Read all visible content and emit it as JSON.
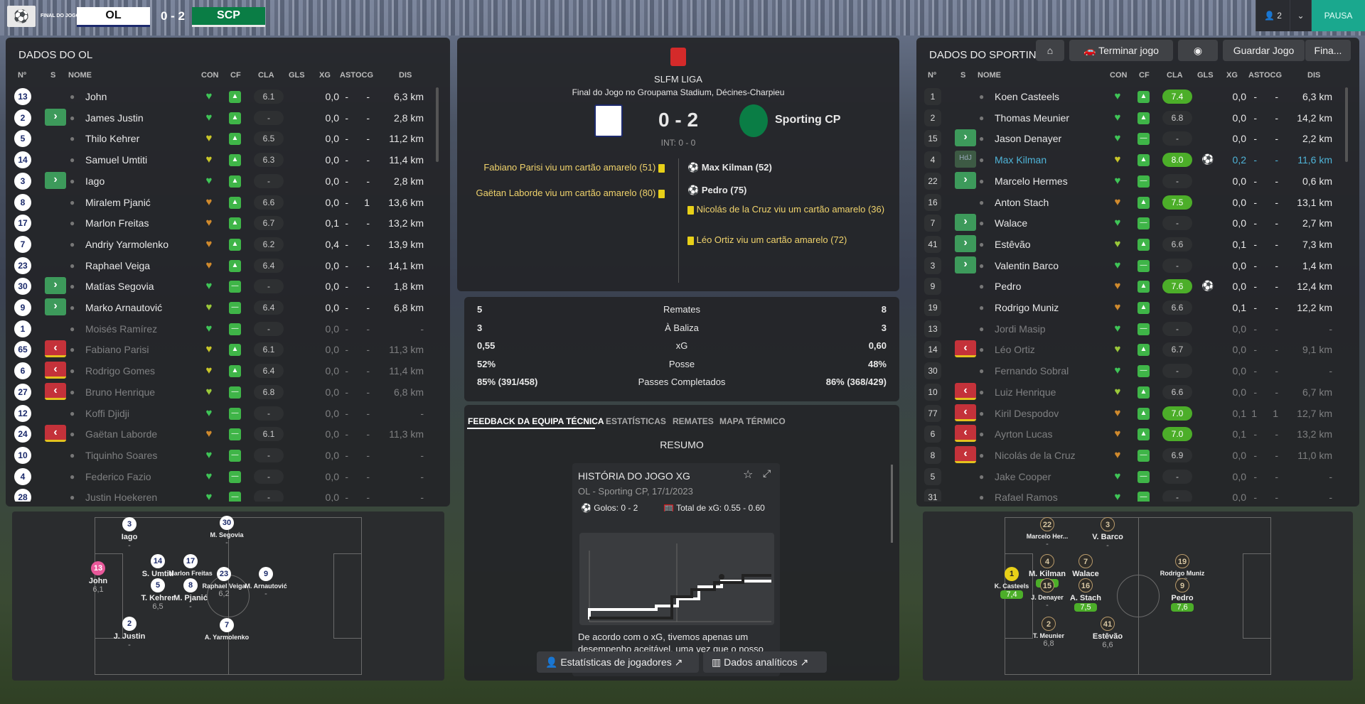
{
  "topbar": {
    "final_label": "FINAL DO JOGO",
    "home": "OL",
    "score": "0 - 2",
    "away": "SCP",
    "users": "2",
    "pause": "PAUSA"
  },
  "actions": {
    "terminate": "Terminar jogo",
    "save": "Guardar Jogo",
    "final": "Fina..."
  },
  "colors": {
    "accent": "#1aa88e",
    "good": "#4cae29",
    "yellow": "#e8d018",
    "red": "#c4323a",
    "sub_in": "#3d9a5b"
  },
  "headers": {
    "no": "Nº",
    "s": "S",
    "name": "NOME",
    "con": "CON",
    "cf": "CF",
    "cla": "CLA",
    "gls": "GLS",
    "xg": "XG",
    "ast": "AST",
    "ocg": "OCG",
    "dis": "DIS"
  },
  "left": {
    "title": "DADOS DO OL",
    "players": [
      {
        "no": "13",
        "s": "",
        "name": "John",
        "cla": "6.1",
        "gls": "",
        "xg": "0,0",
        "ast": "-",
        "ocg": "-",
        "dis": "6,3 km",
        "con": "green",
        "cf": "up"
      },
      {
        "no": "2",
        "s": "in",
        "name": "James Justin",
        "cla": "-",
        "gls": "",
        "xg": "0,0",
        "ast": "-",
        "ocg": "-",
        "dis": "2,8 km",
        "con": "green",
        "cf": "up"
      },
      {
        "no": "5",
        "s": "",
        "name": "Thilo Kehrer",
        "cla": "6.5",
        "gls": "",
        "xg": "0,0",
        "ast": "-",
        "ocg": "-",
        "dis": "11,2 km",
        "con": "yellow",
        "cf": "up"
      },
      {
        "no": "14",
        "s": "",
        "name": "Samuel Umtiti",
        "cla": "6.3",
        "gls": "",
        "xg": "0,0",
        "ast": "-",
        "ocg": "-",
        "dis": "11,4 km",
        "con": "yellow",
        "cf": "up"
      },
      {
        "no": "3",
        "s": "in",
        "name": "Iago",
        "cla": "-",
        "gls": "",
        "xg": "0,0",
        "ast": "-",
        "ocg": "-",
        "dis": "2,8 km",
        "con": "green",
        "cf": "up"
      },
      {
        "no": "8",
        "s": "",
        "name": "Miralem Pjanić",
        "cla": "6.6",
        "gls": "",
        "xg": "0,0",
        "ast": "-",
        "ocg": "1",
        "dis": "13,6 km",
        "con": "orange",
        "cf": "up"
      },
      {
        "no": "17",
        "s": "",
        "name": "Marlon Freitas",
        "cla": "6.7",
        "gls": "",
        "xg": "0,1",
        "ast": "-",
        "ocg": "-",
        "dis": "13,2 km",
        "con": "orange",
        "cf": "up"
      },
      {
        "no": "7",
        "s": "",
        "name": "Andriy Yarmolenko",
        "cla": "6.2",
        "gls": "",
        "xg": "0,4",
        "ast": "-",
        "ocg": "-",
        "dis": "13,9 km",
        "con": "orange",
        "cf": "up"
      },
      {
        "no": "23",
        "s": "",
        "name": "Raphael Veiga",
        "cla": "6.4",
        "gls": "",
        "xg": "0,0",
        "ast": "-",
        "ocg": "-",
        "dis": "14,1 km",
        "con": "orange",
        "cf": "up"
      },
      {
        "no": "30",
        "s": "in",
        "name": "Matías Segovia",
        "cla": "-",
        "gls": "",
        "xg": "0,0",
        "ast": "-",
        "ocg": "-",
        "dis": "1,8 km",
        "con": "green",
        "cf": "dash"
      },
      {
        "no": "9",
        "s": "in",
        "name": "Marko Arnautović",
        "cla": "6.4",
        "gls": "",
        "xg": "0,0",
        "ast": "-",
        "ocg": "-",
        "dis": "6,8 km",
        "con": "lime",
        "cf": "dash"
      },
      {
        "no": "1",
        "s": "",
        "name": "Moisés Ramírez",
        "cla": "-",
        "gls": "",
        "xg": "0,0",
        "ast": "-",
        "ocg": "-",
        "dis": "-",
        "con": "green",
        "cf": "dash",
        "dim": true
      },
      {
        "no": "65",
        "s": "out",
        "name": "Fabiano Parisi",
        "cla": "6.1",
        "gls": "",
        "xg": "0,0",
        "ast": "-",
        "ocg": "-",
        "dis": "11,3 km",
        "con": "yellow",
        "cf": "up",
        "dim": true
      },
      {
        "no": "6",
        "s": "out",
        "name": "Rodrigo Gomes",
        "cla": "6.4",
        "gls": "",
        "xg": "0,0",
        "ast": "-",
        "ocg": "-",
        "dis": "11,4 km",
        "con": "yellow",
        "cf": "up",
        "dim": true
      },
      {
        "no": "27",
        "s": "out",
        "name": "Bruno Henrique",
        "cla": "6.8",
        "gls": "",
        "xg": "0,0",
        "ast": "-",
        "ocg": "-",
        "dis": "6,8 km",
        "con": "lime",
        "cf": "dash",
        "dim": true
      },
      {
        "no": "12",
        "s": "",
        "name": "Koffi Djidji",
        "cla": "-",
        "gls": "",
        "xg": "0,0",
        "ast": "-",
        "ocg": "-",
        "dis": "-",
        "con": "green",
        "cf": "dash",
        "dim": true
      },
      {
        "no": "24",
        "s": "out",
        "name": "Gaëtan Laborde",
        "cla": "6.1",
        "gls": "",
        "xg": "0,0",
        "ast": "-",
        "ocg": "-",
        "dis": "11,3 km",
        "con": "orange",
        "cf": "dash",
        "dim": true
      },
      {
        "no": "10",
        "s": "",
        "name": "Tiquinho Soares",
        "cla": "-",
        "gls": "",
        "xg": "0,0",
        "ast": "-",
        "ocg": "-",
        "dis": "-",
        "con": "green",
        "cf": "dash",
        "dim": true
      },
      {
        "no": "4",
        "s": "",
        "name": "Federico Fazio",
        "cla": "-",
        "gls": "",
        "xg": "0,0",
        "ast": "-",
        "ocg": "-",
        "dis": "-",
        "con": "green",
        "cf": "dash",
        "dim": true
      },
      {
        "no": "28",
        "s": "",
        "name": "Justin Hoekeren",
        "cla": "-",
        "gls": "",
        "xg": "0,0",
        "ast": "-",
        "ocg": "-",
        "dis": "-",
        "con": "green",
        "cf": "dash",
        "dim": true
      }
    ]
  },
  "right": {
    "title": "DADOS DO SPORTING",
    "players": [
      {
        "no": "1",
        "s": "",
        "name": "Koen Casteels",
        "cla": "7.4",
        "gls": "",
        "xg": "0,0",
        "ast": "-",
        "ocg": "-",
        "dis": "6,3 km",
        "con": "green",
        "cf": "up",
        "good": true
      },
      {
        "no": "2",
        "s": "",
        "name": "Thomas Meunier",
        "cla": "6.8",
        "gls": "",
        "xg": "0,0",
        "ast": "-",
        "ocg": "-",
        "dis": "14,2 km",
        "con": "green",
        "cf": "up"
      },
      {
        "no": "15",
        "s": "in",
        "name": "Jason Denayer",
        "cla": "-",
        "gls": "",
        "xg": "0,0",
        "ast": "-",
        "ocg": "-",
        "dis": "2,2 km",
        "con": "green",
        "cf": "dash"
      },
      {
        "no": "4",
        "s": "hdj",
        "name": "Max Kilman",
        "cla": "8.0",
        "gls": "ball",
        "xg": "0,2",
        "ast": "-",
        "ocg": "-",
        "dis": "11,6 km",
        "con": "yellow",
        "cf": "up",
        "good": true,
        "hl": true
      },
      {
        "no": "22",
        "s": "in",
        "name": "Marcelo Hermes",
        "cla": "-",
        "gls": "",
        "xg": "0,0",
        "ast": "-",
        "ocg": "-",
        "dis": "0,6 km",
        "con": "green",
        "cf": "dash"
      },
      {
        "no": "16",
        "s": "",
        "name": "Anton Stach",
        "cla": "7.5",
        "gls": "",
        "xg": "0,0",
        "ast": "-",
        "ocg": "-",
        "dis": "13,1 km",
        "con": "orange",
        "cf": "up",
        "good": true
      },
      {
        "no": "7",
        "s": "in",
        "name": "Walace",
        "cla": "-",
        "gls": "",
        "xg": "0,0",
        "ast": "-",
        "ocg": "-",
        "dis": "2,7 km",
        "con": "green",
        "cf": "dash"
      },
      {
        "no": "41",
        "s": "in",
        "name": "Estêvão",
        "cla": "6.6",
        "gls": "",
        "xg": "0,1",
        "ast": "-",
        "ocg": "-",
        "dis": "7,3 km",
        "con": "lime",
        "cf": "up"
      },
      {
        "no": "3",
        "s": "in",
        "name": "Valentin Barco",
        "cla": "-",
        "gls": "",
        "xg": "0,0",
        "ast": "-",
        "ocg": "-",
        "dis": "1,4 km",
        "con": "green",
        "cf": "dash"
      },
      {
        "no": "9",
        "s": "",
        "name": "Pedro",
        "cla": "7.6",
        "gls": "ball",
        "xg": "0,0",
        "ast": "-",
        "ocg": "-",
        "dis": "12,4 km",
        "con": "orange",
        "cf": "up",
        "good": true
      },
      {
        "no": "19",
        "s": "",
        "name": "Rodrigo Muniz",
        "cla": "6.6",
        "gls": "",
        "xg": "0,1",
        "ast": "-",
        "ocg": "-",
        "dis": "12,2 km",
        "con": "orange",
        "cf": "up"
      },
      {
        "no": "13",
        "s": "",
        "name": "Jordi Masip",
        "cla": "-",
        "gls": "",
        "xg": "0,0",
        "ast": "-",
        "ocg": "-",
        "dis": "-",
        "con": "green",
        "cf": "dash",
        "dim": true
      },
      {
        "no": "14",
        "s": "out",
        "name": "Léo Ortiz",
        "cla": "6.7",
        "gls": "",
        "xg": "0,0",
        "ast": "-",
        "ocg": "-",
        "dis": "9,1 km",
        "con": "lime",
        "cf": "up",
        "dim": true
      },
      {
        "no": "30",
        "s": "",
        "name": "Fernando Sobral",
        "cla": "-",
        "gls": "",
        "xg": "0,0",
        "ast": "-",
        "ocg": "-",
        "dis": "-",
        "con": "green",
        "cf": "dash",
        "dim": true
      },
      {
        "no": "10",
        "s": "out",
        "name": "Luiz Henrique",
        "cla": "6.6",
        "gls": "",
        "xg": "0,0",
        "ast": "-",
        "ocg": "-",
        "dis": "6,7 km",
        "con": "lime",
        "cf": "up",
        "dim": true
      },
      {
        "no": "77",
        "s": "out",
        "name": "Kiril Despodov",
        "cla": "7.0",
        "gls": "",
        "xg": "0,1",
        "ast": "1",
        "ocg": "1",
        "dis": "12,7 km",
        "con": "orange",
        "cf": "up",
        "good": true,
        "dim": true
      },
      {
        "no": "6",
        "s": "out",
        "name": "Ayrton Lucas",
        "cla": "7.0",
        "gls": "",
        "xg": "0,1",
        "ast": "-",
        "ocg": "-",
        "dis": "13,2 km",
        "con": "orange",
        "cf": "up",
        "good": true,
        "dim": true
      },
      {
        "no": "8",
        "s": "out",
        "name": "Nicolás de la Cruz",
        "cla": "6.9",
        "gls": "",
        "xg": "0,0",
        "ast": "-",
        "ocg": "-",
        "dis": "11,0 km",
        "con": "orange",
        "cf": "dash",
        "dim": true
      },
      {
        "no": "5",
        "s": "",
        "name": "Jake Cooper",
        "cla": "-",
        "gls": "",
        "xg": "0,0",
        "ast": "-",
        "ocg": "-",
        "dis": "-",
        "con": "green",
        "cf": "dash",
        "dim": true
      },
      {
        "no": "31",
        "s": "",
        "name": "Rafael Ramos",
        "cla": "-",
        "gls": "",
        "xg": "0,0",
        "ast": "-",
        "ocg": "-",
        "dis": "-",
        "con": "green",
        "cf": "dash",
        "dim": true
      }
    ]
  },
  "match": {
    "league": "SLFM LIGA",
    "venue": "Final do Jogo no Groupama Stadium, Décines-Charpieu",
    "home": "OL",
    "score": "0 - 2",
    "away": "Sporting CP",
    "ht": "INT: 0 - 0",
    "home_events": [
      "Fabiano Parisi viu um cartão amarelo (51)",
      "Gaëtan Laborde viu um cartão amarelo (80)"
    ],
    "away_goals": [
      "Max Kilman (52)",
      "Pedro (75)"
    ],
    "away_cards": [
      "Nicolás de la Cruz viu um cartão amarelo (36)",
      "Léo Ortiz viu um cartão amarelo (72)"
    ]
  },
  "stats": [
    {
      "home": "5",
      "label": "Remates",
      "away": "8"
    },
    {
      "home": "3",
      "label": "À Baliza",
      "away": "3"
    },
    {
      "home": "0,55",
      "label": "xG",
      "away": "0,60"
    },
    {
      "home": "52%",
      "label": "Posse",
      "away": "48%"
    },
    {
      "home": "85% (391/458)",
      "label": "Passes Completados",
      "away": "86% (368/429)"
    }
  ],
  "tabs": [
    "FEEDBACK DA EQUIPA TÉCNICA",
    "ESTATÍSTICAS",
    "REMATES",
    "MAPA TÉRMICO"
  ],
  "summary": {
    "title": "RESUMO",
    "card_title": "HISTÓRIA DO JOGO XG",
    "card_sub": "OL - Sporting CP, 17/1/2023",
    "goals": "Golos: 0 - 2",
    "xg_total": "Total de xG: 0.55 - 0.60",
    "text": "De acordo com o xG, tivemos apenas um desempenho aceitável, uma vez que o nosso"
  },
  "buttons": {
    "player_stats": "Estatísticas de jogadores",
    "analytics": "Dados analíticos"
  },
  "home_pitch": [
    {
      "no": "13",
      "name": "John",
      "r": "6,1",
      "gk": true
    },
    {
      "no": "3",
      "name": "Iago",
      "r": "-"
    },
    {
      "no": "14",
      "name": "S. Umtiti",
      "r": "6,3"
    },
    {
      "no": "5",
      "name": "T. Kehrer",
      "r": "6,5"
    },
    {
      "no": "2",
      "name": "J. Justin",
      "r": "-"
    },
    {
      "no": "17",
      "name": "Marlon Freitas",
      "r": "-",
      "small": true
    },
    {
      "no": "8",
      "name": "M. Pjanić",
      "r": "-"
    },
    {
      "no": "30",
      "name": "M. Segovia",
      "r": "-",
      "small": true
    },
    {
      "no": "23",
      "name": "Raphael Veiga",
      "r": "6,2",
      "small": true
    },
    {
      "no": "7",
      "name": "A. Yarmolenko",
      "r": "",
      "small": true
    },
    {
      "no": "9",
      "name": "M. Arnautović",
      "r": "-",
      "small": true
    }
  ],
  "away_pitch": [
    {
      "no": "1",
      "name": "K. Casteels",
      "r": "7,4",
      "gk": true,
      "good": true,
      "small": true
    },
    {
      "no": "22",
      "name": "Marcelo Her...",
      "r": "-",
      "small": true
    },
    {
      "no": "4",
      "name": "M. Kilman",
      "r": "8,0",
      "good": true
    },
    {
      "no": "15",
      "name": "J. Denayer",
      "r": "-",
      "small": true
    },
    {
      "no": "2",
      "name": "T. Meunier",
      "r": "6,8",
      "small": true
    },
    {
      "no": "3",
      "name": "V. Barco",
      "r": "-"
    },
    {
      "no": "7",
      "name": "Walace",
      "r": "-"
    },
    {
      "no": "16",
      "name": "A. Stach",
      "r": "7,5",
      "good": true
    },
    {
      "no": "41",
      "name": "Estêvão",
      "r": "6,6"
    },
    {
      "no": "19",
      "name": "Rodrigo Muniz",
      "r": "6,6",
      "small": true
    },
    {
      "no": "9",
      "name": "Pedro",
      "r": "7,6",
      "good": true
    }
  ]
}
